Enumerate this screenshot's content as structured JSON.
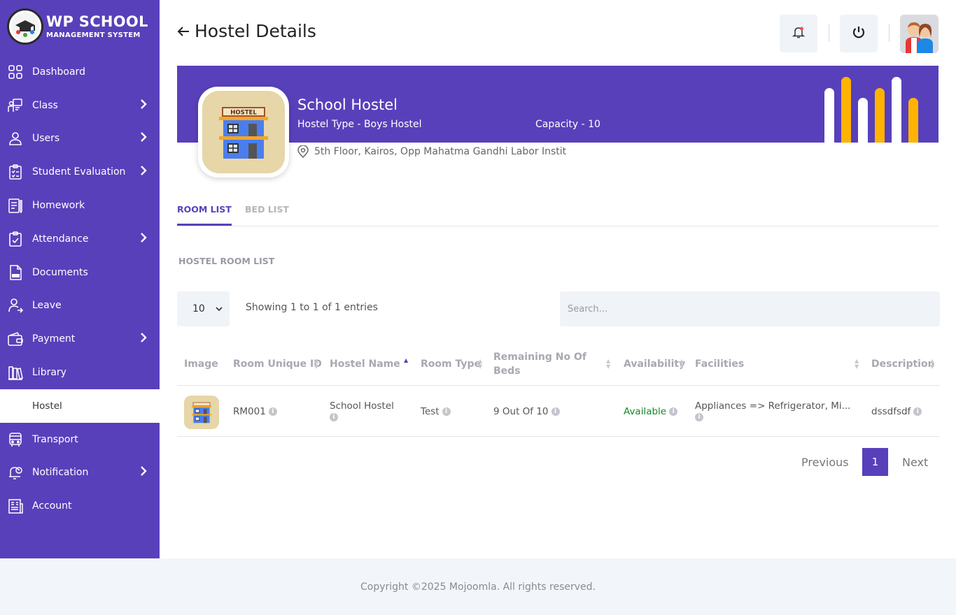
{
  "app": {
    "logo_title": "WP SCHOOL",
    "logo_subtitle": "MANAGEMENT SYSTEM"
  },
  "sidebar": {
    "items": [
      {
        "label": "Dashboard",
        "icon": "dashboard-icon",
        "has_submenu": false
      },
      {
        "label": "Class",
        "icon": "class-icon",
        "has_submenu": true
      },
      {
        "label": "Users",
        "icon": "user-icon",
        "has_submenu": true
      },
      {
        "label": "Student Evaluation",
        "icon": "clipboard-icon",
        "has_submenu": true
      },
      {
        "label": "Homework",
        "icon": "homework-icon",
        "has_submenu": false
      },
      {
        "label": "Attendance",
        "icon": "attendance-icon",
        "has_submenu": true
      },
      {
        "label": "Documents",
        "icon": "document-icon",
        "has_submenu": false
      },
      {
        "label": "Leave",
        "icon": "leave-icon",
        "has_submenu": false
      },
      {
        "label": "Payment",
        "icon": "wallet-icon",
        "has_submenu": true
      },
      {
        "label": "Library",
        "icon": "library-icon",
        "has_submenu": false
      },
      {
        "label": "Hostel",
        "icon": "",
        "has_submenu": false,
        "active": true
      },
      {
        "label": "Transport",
        "icon": "bus-icon",
        "has_submenu": false
      },
      {
        "label": "Notification",
        "icon": "notification-icon",
        "has_submenu": true
      },
      {
        "label": "Account",
        "icon": "account-icon",
        "has_submenu": false
      }
    ]
  },
  "header": {
    "title": "Hostel Details"
  },
  "hostel": {
    "name": "School Hostel",
    "type": "Hostel Type - Boys Hostel",
    "capacity": "Capacity - 10",
    "address": "5th Floor, Kairos, Opp Mahatma Gandhi Labor Instit",
    "sign_text": "HOSTEL"
  },
  "tabs": [
    {
      "label": "ROOM LIST",
      "active": true
    },
    {
      "label": "BED LIST",
      "active": false
    }
  ],
  "section_title": "HOSTEL ROOM LIST",
  "table_controls": {
    "page_length": "10",
    "showing_text": "Showing 1 to 1 of 1 entries",
    "search_placeholder": "Search..."
  },
  "table": {
    "columns": [
      "Image",
      "Room Unique ID",
      "Hostel Name",
      "Room Type",
      "Remaining No Of Beds",
      "Availability",
      "Facilities",
      "Description"
    ],
    "rows": [
      {
        "room_id": "RM001",
        "hostel_name": "School Hostel",
        "room_type": "Test",
        "remaining_beds": "9 Out Of 10",
        "availability": "Available",
        "facilities": "Appliances => Refrigerator, Mi...",
        "description": "dssdfsdf"
      }
    ]
  },
  "pagination": {
    "previous": "Previous",
    "current": "1",
    "next": "Next"
  },
  "footer": {
    "copyright": "Copyright ©2025 Mojoomla. All rights reserved."
  },
  "colors": {
    "brand": "#5840bb",
    "accent_bar": "#ffb300",
    "available": "#178a2a"
  }
}
